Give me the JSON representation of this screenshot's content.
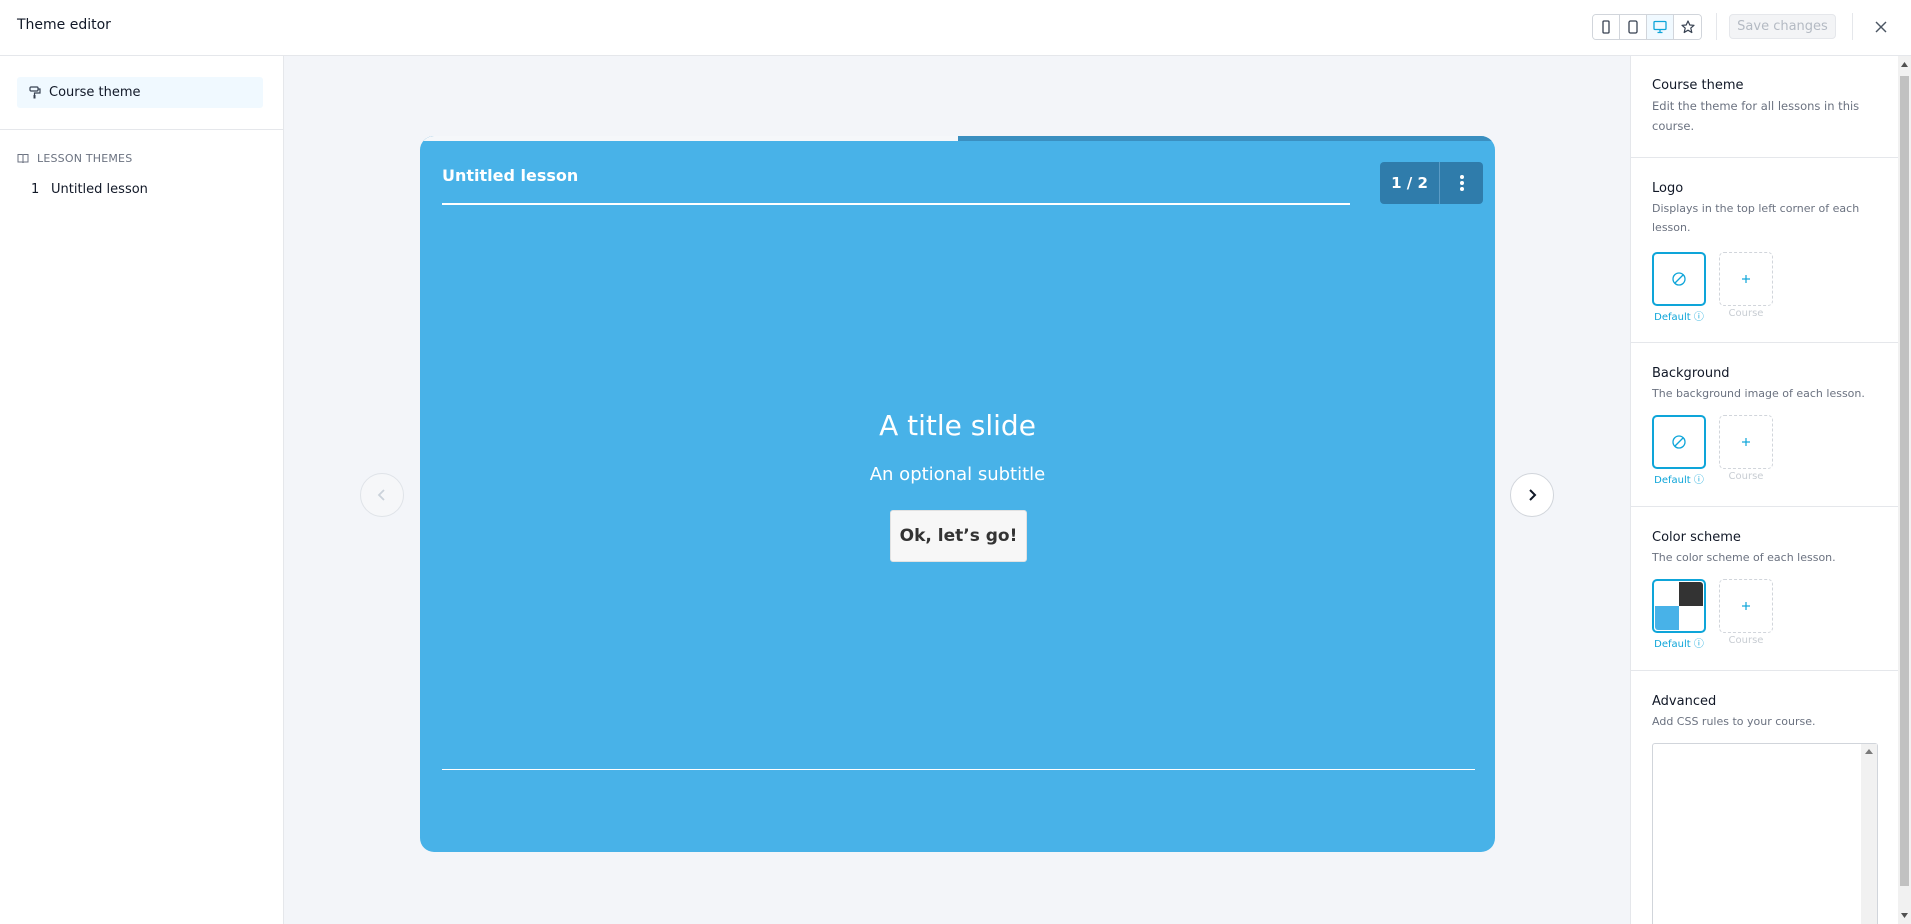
{
  "topbar": {
    "title": "Theme editor",
    "devices": [
      {
        "name": "phone-small-icon",
        "active": false
      },
      {
        "name": "phone-icon",
        "active": false
      },
      {
        "name": "desktop-icon",
        "active": true
      },
      {
        "name": "star-icon",
        "active": false
      }
    ],
    "save_label": "Save changes"
  },
  "sidebar": {
    "course_theme_label": "Course theme",
    "section_label": "LESSON THEMES",
    "lessons": [
      {
        "number": "1",
        "title": "Untitled lesson"
      }
    ]
  },
  "slide": {
    "lesson_title": "Untitled lesson",
    "counter": "1 / 2",
    "progress": 0.5,
    "heading": "A title slide",
    "subtitle": "An optional subtitle",
    "cta_label": "Ok, let’s go!"
  },
  "panel": {
    "header": {
      "title": "Course theme",
      "desc": "Edit the theme for all lessons in this course."
    },
    "logo": {
      "title": "Logo",
      "desc": "Displays in the top left corner of each lesson.",
      "default_label": "Default",
      "course_label": "Course"
    },
    "background": {
      "title": "Background",
      "desc": "The background image of each lesson.",
      "default_label": "Default",
      "course_label": "Course"
    },
    "color_scheme": {
      "title": "Color scheme",
      "desc": "The color scheme of each lesson.",
      "default_label": "Default",
      "course_label": "Course",
      "swatch_colors": [
        "#ffffff",
        "#333333",
        "#48b2e8",
        "#ffffff"
      ]
    },
    "advanced": {
      "title": "Advanced",
      "desc": "Add CSS rules to your course."
    }
  },
  "colors": {
    "accent": "#0ea5d9",
    "slide_bg": "#48b2e8",
    "counter_bg": "#2f7cab"
  }
}
